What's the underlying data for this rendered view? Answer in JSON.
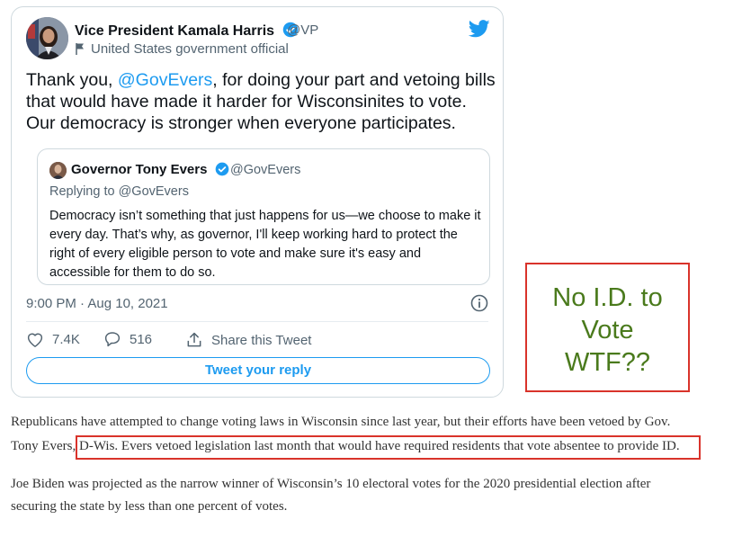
{
  "tweet": {
    "author_name": "Vice President Kamala Harris",
    "author_handle": "@VP",
    "affiliation": "United States government official",
    "text_before": "Thank you, ",
    "mention": "@GovEvers",
    "text_after": ", for doing your part and vetoing bills that would have made it harder for Wisconsinites to vote. Our democracy is stronger when everyone participates.",
    "timestamp": "9:00 PM · Aug 10, 2021",
    "likes": "7.4K",
    "replies": "516",
    "share_label": "Share this Tweet",
    "reply_button_label": "Tweet your reply",
    "accent_color": "#1d9bf0"
  },
  "quoted_tweet": {
    "author_name": "Governor Tony Evers",
    "author_handle": "@GovEvers",
    "replying_to": "Replying to @GovEvers",
    "text": "Democracy isn’t something that just happens for us—we choose to make it every day. That’s why, as governor, I'll keep working hard to protect the right of every eligible person to vote and make sure it's easy and accessible for them to do so."
  },
  "annotation": {
    "line1": "No I.D. to",
    "line2": "Vote",
    "line3": "WTF??",
    "border_color": "#d9332b",
    "text_color": "#4a7a1c"
  },
  "article": {
    "p1_line1": "Republicans have attempted to change voting laws in Wisconsin since last year, but their efforts have been vetoed by Gov.",
    "p1_line2_pre": "Tony Evers, ",
    "p1_line2_highlight": "D-Wis. Evers vetoed legislation last month that would have required residents that vote absentee to provide ID.",
    "p2_line1": "Joe Biden was projected as the narrow winner of Wisconsin’s 10 electoral votes for the 2020 presidential election after",
    "p2_line2": "securing the state by less than one percent of votes."
  }
}
